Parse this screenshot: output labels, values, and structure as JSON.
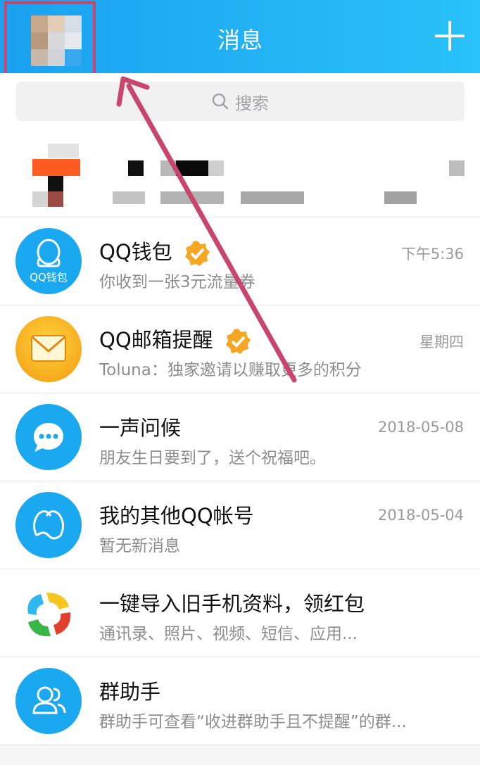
{
  "header": {
    "title": "消息"
  },
  "search": {
    "placeholder": "搜索"
  },
  "conversations": [
    {
      "name": "QQ钱包",
      "icon_label": "QQ钱包",
      "preview": "你收到一张3元流量券",
      "time": "下午5:36",
      "verified": true
    },
    {
      "name": "QQ邮箱提醒",
      "preview": "Toluna：独家邀请以赚取更多的积分",
      "time": "星期四",
      "verified": true
    },
    {
      "name": "一声问候",
      "preview": "朋友生日要到了，送个祝福吧。",
      "time": "2018-05-08",
      "verified": false
    },
    {
      "name": "我的其他QQ帐号",
      "preview": "暂无新消息",
      "time": "2018-05-04",
      "verified": false
    },
    {
      "name": "一键导入旧手机资料，领红包",
      "preview": "通讯录、照片、视频、短信、应用...",
      "time": "",
      "verified": false
    },
    {
      "name": "群助手",
      "preview": "群助手可查看“收进群助手且不提醒”的群...",
      "time": "",
      "verified": false
    }
  ],
  "colors": {
    "header_start": "#1aa1ef",
    "header_end": "#29c2fa",
    "annotation": "#c8466e",
    "verified": "#f5a623",
    "icon_blue": "#1aa8f0"
  }
}
